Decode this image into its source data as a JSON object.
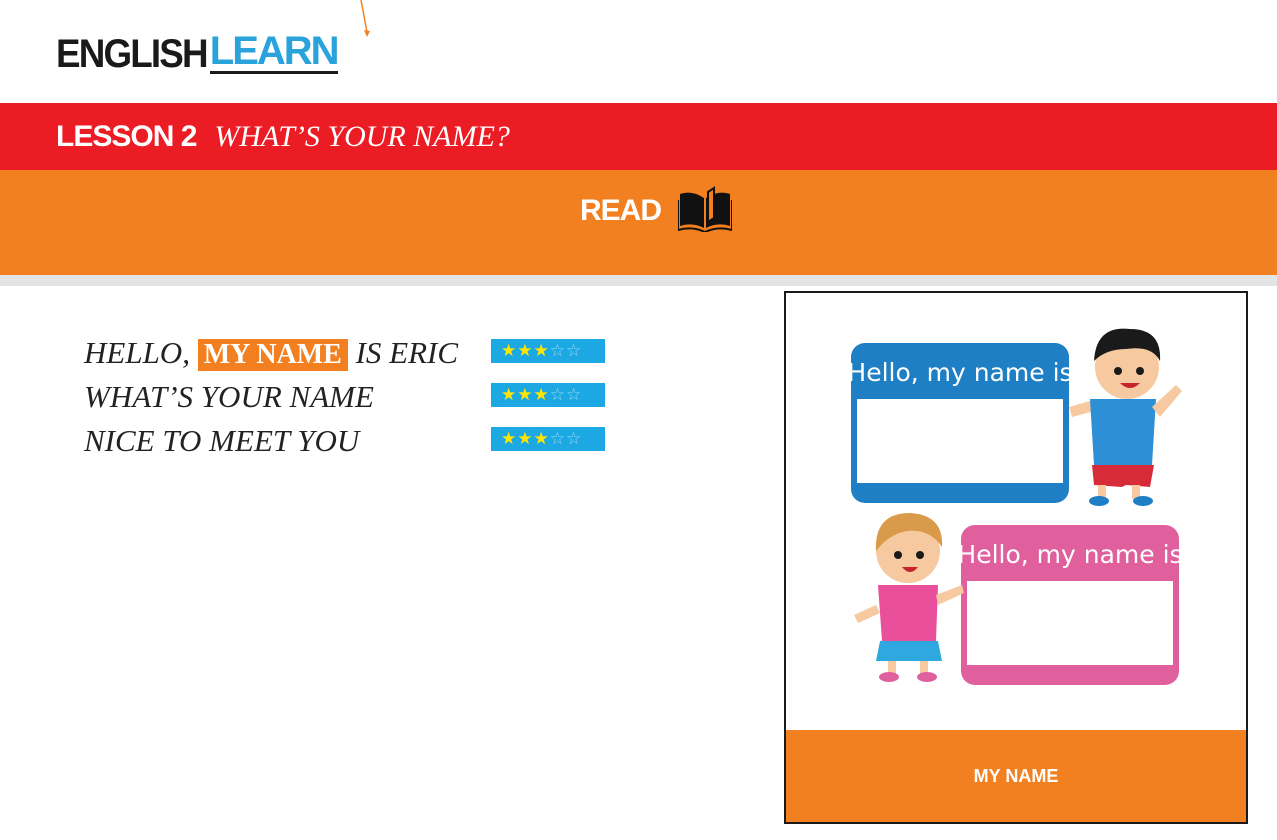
{
  "brand": {
    "part1": "ENGLISH",
    "part2": "LEARN"
  },
  "lesson": {
    "number": "LESSON 2",
    "title": "WHAT’S YOUR NAME?"
  },
  "section": {
    "label": "READ",
    "icon": "open-book-icon"
  },
  "phrases": [
    {
      "before": "HELLO, ",
      "highlight": "MY NAME",
      "after": " IS ERIC",
      "stars_filled": 3,
      "stars_total": 5
    },
    {
      "text": "WHAT’S YOUR NAME",
      "stars_filled": 3,
      "stars_total": 5
    },
    {
      "text": "NICE TO MEET YOU",
      "stars_filled": 3,
      "stars_total": 5
    }
  ],
  "card": {
    "tag_text": "Hello, my name is",
    "caption": "MY NAME"
  },
  "colors": {
    "red": "#ec1c24",
    "orange": "#f38020",
    "blue": "#1ca8e2",
    "brand_blue": "#2aa3dc",
    "tag_blue": "#1e7fc4",
    "tag_pink": "#e0609e"
  }
}
